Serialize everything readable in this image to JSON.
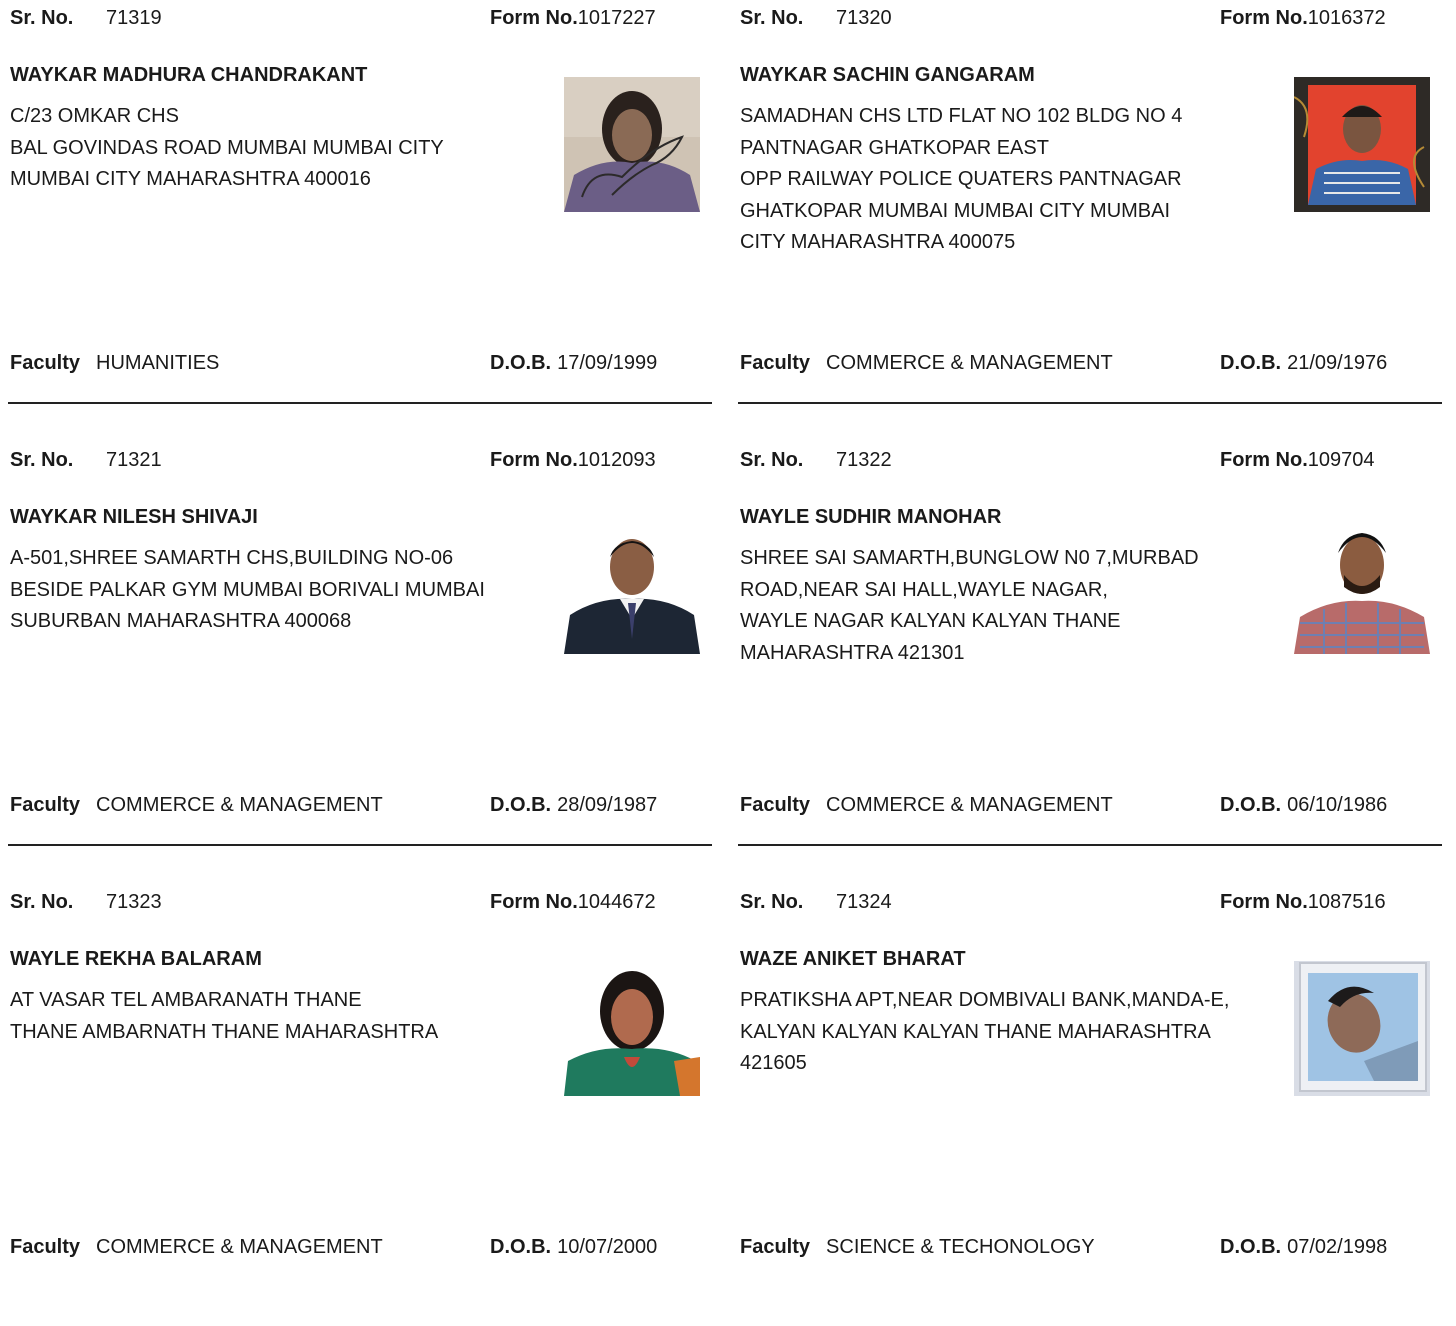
{
  "labels": {
    "sr": "Sr. No.",
    "form": "Form No.",
    "faculty": "Faculty",
    "dob": "D.O.B."
  },
  "cards": [
    {
      "sr": "71319",
      "form": "1017227",
      "name": "WAYKAR MADHURA CHANDRAKANT",
      "address": "C/23 OMKAR CHS\nBAL GOVINDAS ROAD MUMBAI MUMBAI CITY\nMUMBAI CITY MAHARASHTRA 400016",
      "faculty": "HUMANITIES",
      "dob": "17/09/1999",
      "photo": "photo-woman-signature"
    },
    {
      "sr": "71320",
      "form": "1016372",
      "name": "WAYKAR SACHIN GANGARAM",
      "address": "SAMADHAN CHS LTD FLAT NO 102 BLDG NO 4\nPANTNAGAR  GHATKOPAR EAST\nOPP RAILWAY POLICE QUATERS PANTNAGAR\nGHATKOPAR MUMBAI MUMBAI CITY MUMBAI\nCITY MAHARASHTRA 400075",
      "faculty": "COMMERCE & MANAGEMENT",
      "dob": "21/09/1976",
      "photo": "photo-man-red-background"
    },
    {
      "sr": "71321",
      "form": "1012093",
      "name": "WAYKAR NILESH SHIVAJI",
      "address": "A-501,SHREE SAMARTH CHS,BUILDING NO-06\nBESIDE PALKAR GYM MUMBAI BORIVALI MUMBAI\nSUBURBAN MAHARASHTRA 400068",
      "faculty": "COMMERCE & MANAGEMENT",
      "dob": "28/09/1987",
      "photo": "photo-man-suit"
    },
    {
      "sr": "71322",
      "form": "109704",
      "name": "WAYLE SUDHIR MANOHAR",
      "address": "SHREE SAI SAMARTH,BUNGLOW N0 7,MURBAD\nROAD,NEAR SAI HALL,WAYLE NAGAR,\nWAYLE NAGAR KALYAN KALYAN THANE\nMAHARASHTRA 421301",
      "faculty": "COMMERCE & MANAGEMENT",
      "dob": "06/10/1986",
      "photo": "photo-man-checked-shirt"
    },
    {
      "sr": "71323",
      "form": "1044672",
      "name": "WAYLE REKHA BALARAM",
      "address": "AT VASAR TEL AMBARANATH  THANE\n THANE AMBARNATH THANE MAHARASHTRA",
      "faculty": "COMMERCE & MANAGEMENT",
      "dob": "10/07/2000",
      "photo": "photo-woman-green"
    },
    {
      "sr": "71324",
      "form": "1087516",
      "name": "WAZE ANIKET BHARAT",
      "address": "PRATIKSHA APT,NEAR DOMBIVALI BANK,MANDA-E,\nKALYAN KALYAN KALYAN THANE MAHARASHTRA\n421605",
      "faculty": "SCIENCE & TECHONOLOGY",
      "dob": "07/02/1998",
      "photo": "photo-man-photo-of-photo"
    }
  ]
}
